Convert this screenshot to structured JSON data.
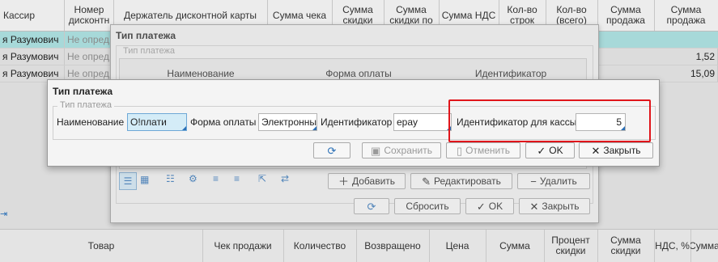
{
  "main_grid": {
    "headers": [
      "Кассир",
      "Номер дисконтн",
      "Держатель дисконтной карты",
      "Сумма чека",
      "Сумма скидки",
      "Сумма скидки по",
      "Сумма НДС",
      "Кол-во строк",
      "Кол-во (всего)",
      "Сумма продажа",
      "Сумма продажа"
    ],
    "rows": [
      {
        "cashier": "я Разумович",
        "card": "Не опред",
        "extra1": "",
        "extra2": ""
      },
      {
        "cashier": "я Разумович",
        "card": "Не опред",
        "extra1": "",
        "extra2": "1,52"
      },
      {
        "cashier": "я Разумович",
        "card": "Не опред",
        "extra1": "",
        "extra2": "15,09"
      }
    ]
  },
  "bottom_grid": {
    "headers": [
      "Товар",
      "Чек продажи",
      "Количество",
      "Возвращено",
      "Цена",
      "Сумма",
      "Процент скидки",
      "Сумма скидки",
      "НДС, %",
      "Сумма"
    ]
  },
  "payment_window": {
    "title": "Тип платежа",
    "group_label": "Тип платежа",
    "columns": [
      "Наименование",
      "Форма оплаты",
      "Идентификатор"
    ],
    "toolbar": {
      "add": "Добавить",
      "edit": "Редактировать",
      "delete": "Удалить"
    },
    "footer": {
      "reset": "Сбросить",
      "ok": "OK",
      "close": "Закрыть"
    }
  },
  "edit_dialog": {
    "title": "Тип платежа",
    "group_label": "Тип платежа",
    "name_label": "Наименование",
    "name_value": "О!плати",
    "form_label": "Форма оплаты",
    "form_value": "Электронны",
    "id_label": "Идентификатор",
    "id_value": "epay",
    "cash_id_label": "Идентификатор для кассы",
    "cash_id_value": "5",
    "buttons": {
      "save": "Сохранить",
      "cancel": "Отменить",
      "ok": "OK",
      "close": "Закрыть"
    }
  },
  "colors": {
    "highlight_box": "#e0151b",
    "selected_row": "#a7d9d9",
    "accent": "#2a6fb6"
  }
}
